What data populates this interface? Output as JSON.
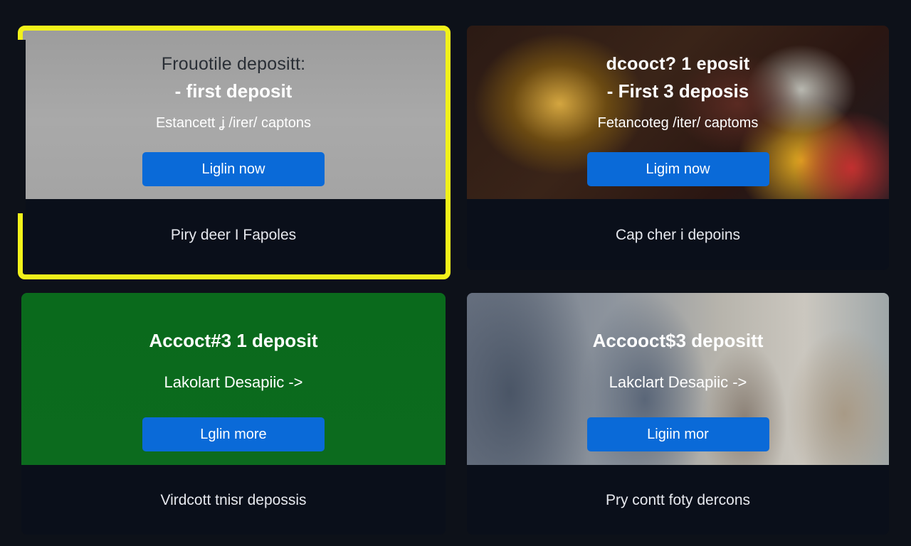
{
  "cards": [
    {
      "heading": "Frouotile depositt:",
      "subheading": "- first deposit",
      "caption": "Estancett ʝ /irer/ captons",
      "button": "Liglin now",
      "footer": "Piry deer I Fapoles"
    },
    {
      "heading": "dcooct? 1  eposit",
      "subheading": "- First 3 deposis",
      "caption": "Fetancoteg /iter/ captoms",
      "button": "Ligim now",
      "footer": "Cap cher i depoins"
    },
    {
      "heading": "Accoct#3 1 deposit",
      "link": "Lakolart Desapiic ->",
      "button": "Lglin more",
      "footer": "Virdcott tnisr depossis"
    },
    {
      "heading": "Accooct$3 depositt",
      "link": "Lakclart Desapiic ->",
      "button": "Ligiin mor",
      "footer": "Pry contt foty dercons"
    }
  ],
  "colors": {
    "page_bg": "#0d1119",
    "button": "#0a6ad8",
    "highlight": "#f2f21a",
    "green_banner": "#0c6b1e"
  }
}
